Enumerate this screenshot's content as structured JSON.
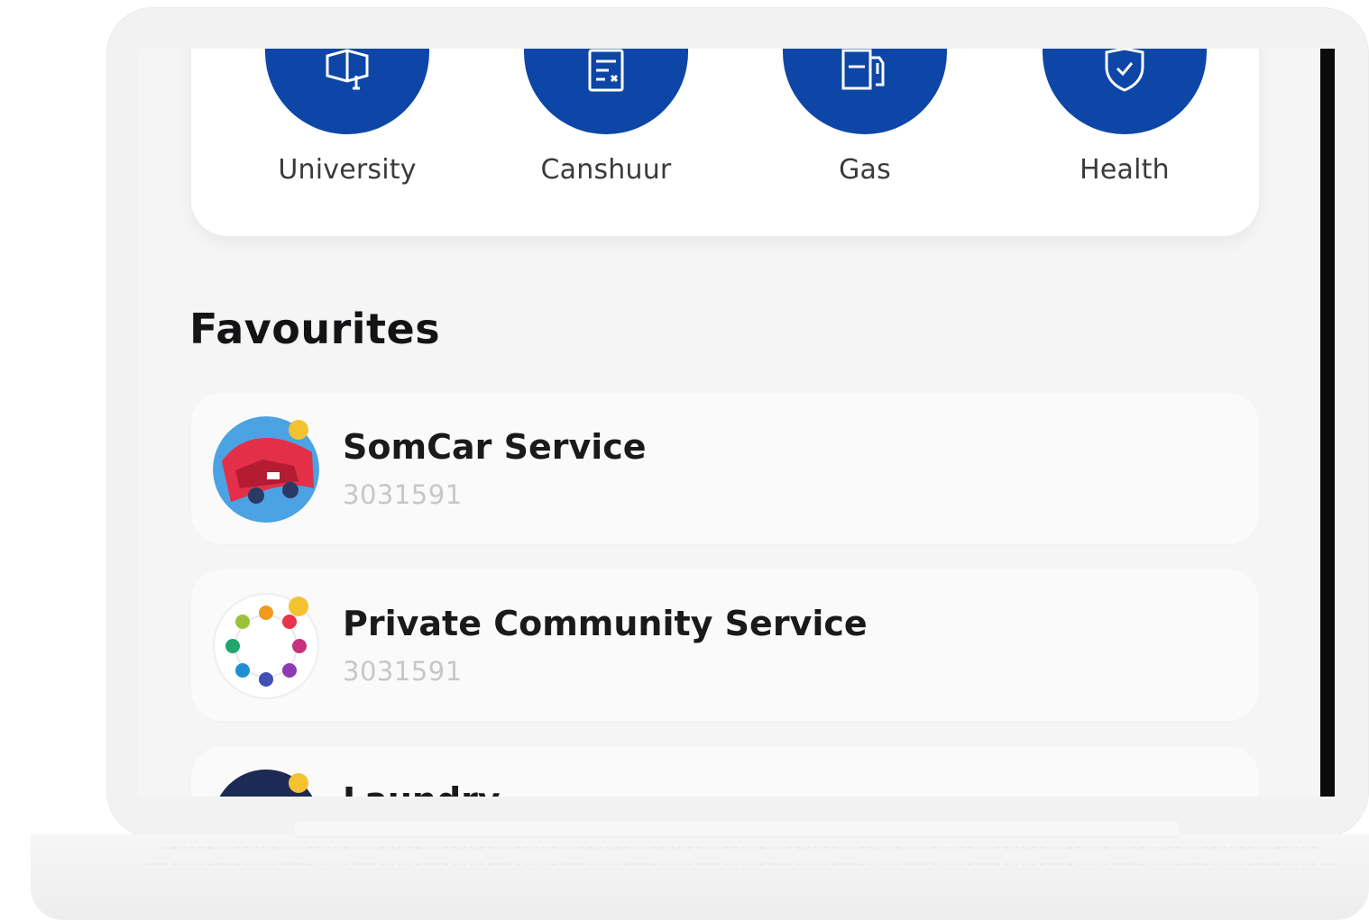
{
  "categories": [
    {
      "label": "University",
      "icon": "book-icon"
    },
    {
      "label": "Canshuur",
      "icon": "invoice-icon"
    },
    {
      "label": "Gas",
      "icon": "gas-icon"
    },
    {
      "label": "Health",
      "icon": "heart-shield-icon"
    }
  ],
  "favourites": {
    "title": "Favourites",
    "items": [
      {
        "name": "SomCar Service",
        "code": "3031591"
      },
      {
        "name": "Private Community Service",
        "code": "3031591"
      },
      {
        "name": "Laundry",
        "code": ""
      }
    ]
  },
  "colors": {
    "accent": "#0d46a6",
    "badge": "#f4c22f"
  }
}
